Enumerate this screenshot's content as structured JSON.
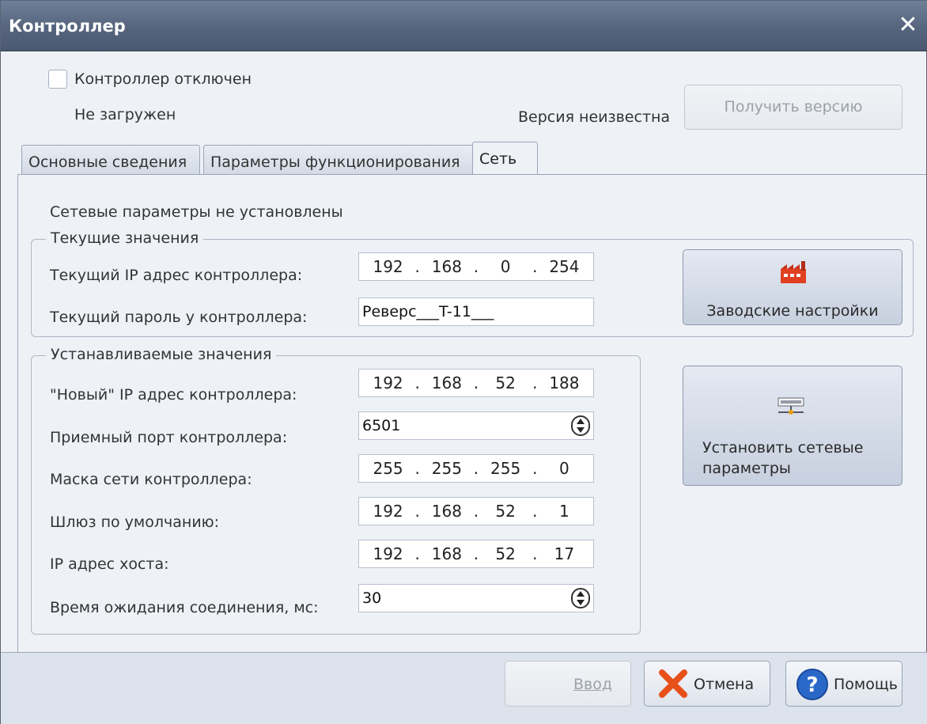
{
  "window": {
    "title": "Контроллер",
    "close_icon": "close-icon"
  },
  "status": {
    "disabled_checkbox_label": "Контроллер отключен",
    "load_state": "Не загружен",
    "version_text": "Версия неизвестна",
    "get_version_label": "Получить версию"
  },
  "tabs": [
    {
      "label": "Основные сведения",
      "active": false
    },
    {
      "label": "Параметры функционирования",
      "active": false
    },
    {
      "label": "Сеть",
      "active": true
    }
  ],
  "network": {
    "warning": "Сетевые параметры не установлены",
    "current": {
      "legend": "Текущие значения",
      "ip_label": "Текущий IP адрес контроллера:",
      "ip": [
        "192",
        "168",
        "0",
        "254"
      ],
      "password_label": "Текущий пароль у контроллера:",
      "password": "Реверс___T-11___"
    },
    "new": {
      "legend": "Устанавливаемые значения",
      "ip_label": "\"Новый\" IP адрес контроллера:",
      "ip": [
        "192",
        "168",
        "52",
        "188"
      ],
      "port_label": "Приемный порт контроллера:",
      "port": "6501",
      "mask_label": "Маска сети контроллера:",
      "mask": [
        "255",
        "255",
        "255",
        "0"
      ],
      "gateway_label": "Шлюз  по  умолчанию:",
      "gateway": [
        "192",
        "168",
        "52",
        "1"
      ],
      "host_label": "IP адрес хоста:",
      "host": [
        "192",
        "168",
        "52",
        "17"
      ],
      "timeout_label": "Время ожидания соединения, мс:",
      "timeout": "30"
    },
    "factory_button": "Заводские настройки",
    "apply_button_line1": "Установить сетевые",
    "apply_button_line2": "параметры"
  },
  "footer": {
    "ok_label": "Ввод",
    "cancel_label": "Отмена",
    "help_label": "Помощь"
  },
  "colors": {
    "titlebar": "#56657d",
    "error": "#f20000",
    "background": "#eef1f6"
  }
}
